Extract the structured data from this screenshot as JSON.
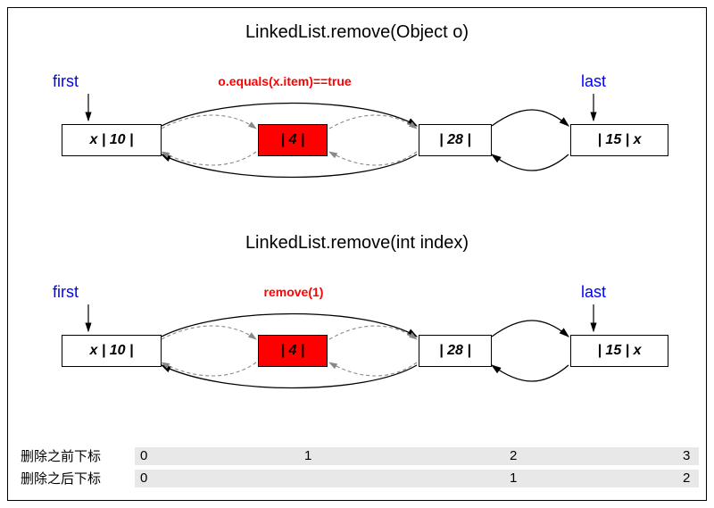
{
  "title1": "LinkedList.remove(Object o)",
  "title2": "LinkedList.remove(int index)",
  "first_label": "first",
  "last_label": "last",
  "red_label1": "o.equals(x.item)==true",
  "red_label2": "remove(1)",
  "nodes": {
    "n0": "x | 10 |",
    "n1": "| 4 |",
    "n2": "| 28 |",
    "n3": "| 15 | x"
  },
  "index_before_label": "删除之前下标",
  "index_after_label": "删除之后下标",
  "idx_before": {
    "i0": "0",
    "i1": "1",
    "i2": "2",
    "i3": "3"
  },
  "idx_after": {
    "i0": "0",
    "i1": "1",
    "i2": "2"
  }
}
